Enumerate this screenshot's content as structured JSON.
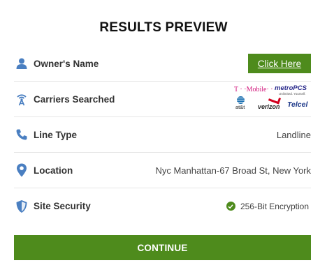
{
  "title": "RESULTS PREVIEW",
  "rows": {
    "owner": {
      "label": "Owner's Name",
      "button": "Click Here",
      "icon": "user-icon"
    },
    "carriers": {
      "label": "Carriers Searched",
      "icon": "signal-tower-icon",
      "logos": {
        "tmobile": "T · ·Mobile· ·",
        "metro": "metroPCS",
        "metro_sub": "Unlimited. Yourself.",
        "att": "at&t",
        "verizon": "verizon",
        "telcel": "Telcel"
      }
    },
    "line_type": {
      "label": "Line Type",
      "value": "Landline",
      "icon": "phone-icon"
    },
    "location": {
      "label": "Location",
      "value": "Nyc Manhattan-67 Broad St, New York",
      "icon": "map-pin-icon"
    },
    "security": {
      "label": "Site Security",
      "value": "256-Bit Encryption",
      "icon": "shield-icon"
    }
  },
  "continue_label": "CONTINUE",
  "colors": {
    "accent": "#4e8b1c",
    "icon": "#4a7fc1"
  }
}
